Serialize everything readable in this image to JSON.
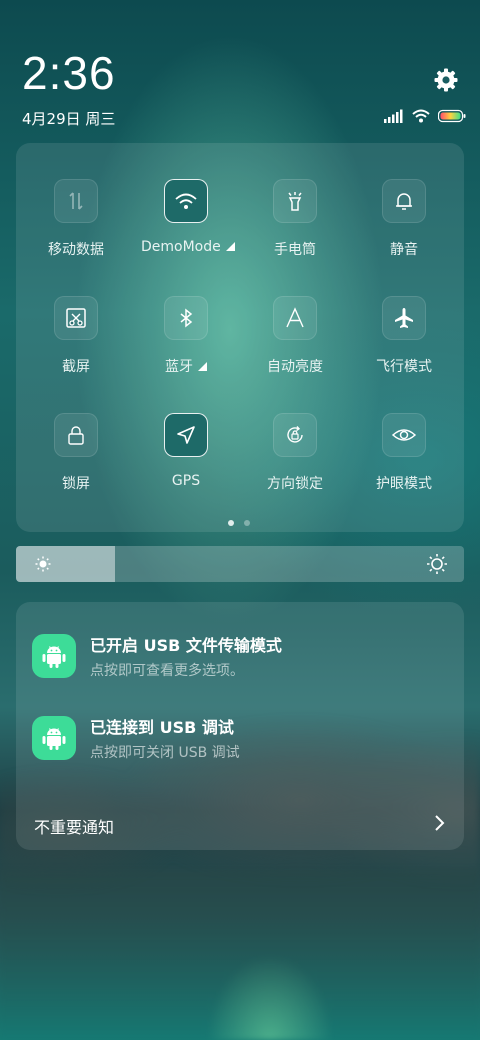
{
  "status": {
    "time": "2:36",
    "date": "4月29日 周三"
  },
  "quick_settings": {
    "tiles": [
      {
        "label": "移动数据",
        "icon": "mobile-data-icon",
        "active": false
      },
      {
        "label": "DemoMode",
        "icon": "wifi-icon",
        "active": true,
        "expandable": true
      },
      {
        "label": "手电筒",
        "icon": "flashlight-icon",
        "active": false
      },
      {
        "label": "静音",
        "icon": "bell-icon",
        "active": false
      },
      {
        "label": "截屏",
        "icon": "screenshot-icon",
        "active": false
      },
      {
        "label": "蓝牙",
        "icon": "bluetooth-icon",
        "active": false,
        "expandable": true
      },
      {
        "label": "自动亮度",
        "icon": "auto-brightness-icon",
        "active": false
      },
      {
        "label": "飞行模式",
        "icon": "airplane-icon",
        "active": false
      },
      {
        "label": "锁屏",
        "icon": "lock-icon",
        "active": false
      },
      {
        "label": "GPS",
        "icon": "location-icon",
        "active": true
      },
      {
        "label": "方向锁定",
        "icon": "rotation-lock-icon",
        "active": false
      },
      {
        "label": "护眼模式",
        "icon": "eye-icon",
        "active": false
      }
    ],
    "page_count": 2,
    "current_page": 1
  },
  "brightness": {
    "level": 0.22
  },
  "notifications": {
    "items": [
      {
        "title": "已开启 USB 文件传输模式",
        "text": "点按即可查看更多选项。",
        "icon": "android-icon"
      },
      {
        "title": "已连接到 USB 调试",
        "text": "点按即可关闭 USB 调试",
        "icon": "android-icon"
      }
    ],
    "unimportant_label": "不重要通知"
  },
  "colors": {
    "active_tile": "#1e6a68",
    "notification_icon": "#3ddc98",
    "battery_gradient": [
      "#ff4f6b",
      "#ffd23f",
      "#3ee08a"
    ]
  }
}
